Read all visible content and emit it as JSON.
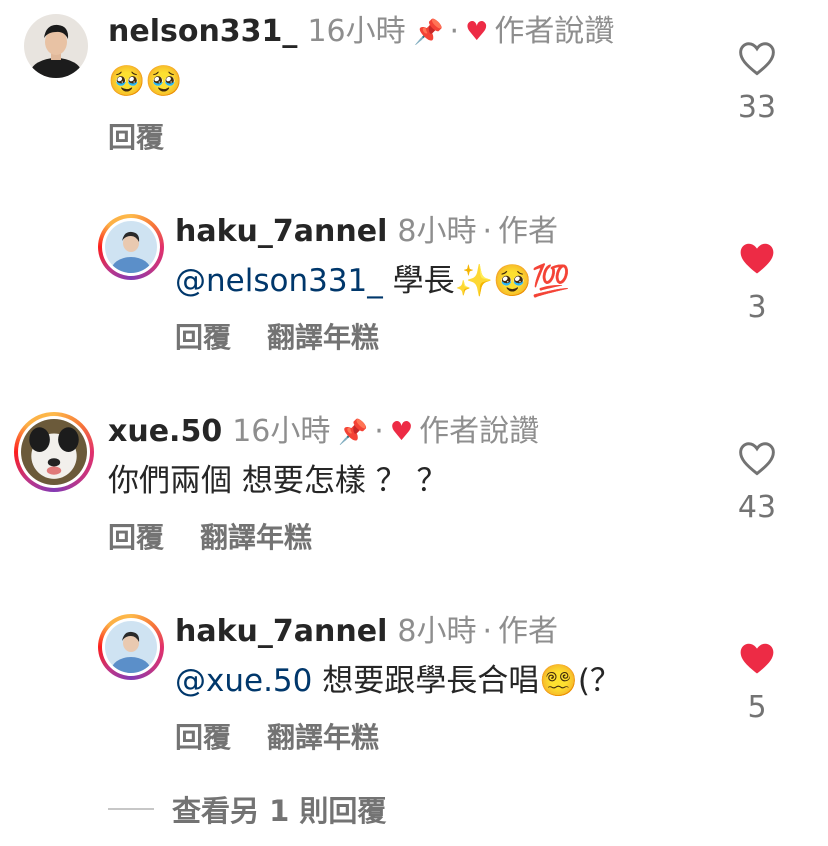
{
  "comments": [
    {
      "username": "nelson331_",
      "time": "16小時",
      "pin_icon": "pin-icon",
      "liked_by_author": "作者說讚",
      "text": "🥹🥹",
      "reply_label": "回覆",
      "like_count": "33",
      "liked": false
    },
    {
      "username": "haku_7annel",
      "time": "8小時",
      "author_label": "作者",
      "mention": "@nelson331_",
      "text": "學長✨🥹💯",
      "reply_label": "回覆",
      "translate_label": "翻譯年糕",
      "like_count": "3",
      "liked": true
    },
    {
      "username": "xue.50",
      "time": "16小時",
      "pin_icon": "pin-icon",
      "liked_by_author": "作者說讚",
      "text": "你們兩個 想要怎樣 ？ ？",
      "reply_label": "回覆",
      "translate_label": "翻譯年糕",
      "like_count": "43",
      "liked": false
    },
    {
      "username": "haku_7annel",
      "time": "8小時",
      "author_label": "作者",
      "mention": "@xue.50",
      "text": "想要跟學長合唱😵‍💫(？",
      "reply_label": "回覆",
      "translate_label": "翻譯年糕",
      "like_count": "5",
      "liked": true
    }
  ],
  "view_more": "查看另 1 則回覆",
  "colors": {
    "like_red": "#ed2b45",
    "mention_blue": "#00376b",
    "muted": "#8e8e8e"
  }
}
